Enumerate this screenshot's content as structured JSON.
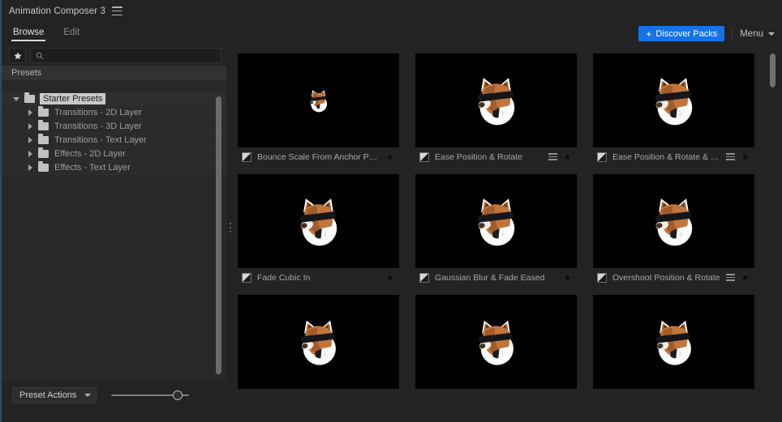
{
  "window": {
    "title": "Animation Composer 3",
    "menu_icon": "hamburger-icon"
  },
  "tabs": [
    {
      "label": "Browse",
      "active": true
    },
    {
      "label": "Edit",
      "active": false
    }
  ],
  "toolbar": {
    "discover_plus": "+",
    "discover_label": "Discover Packs",
    "menu_label": "Menu",
    "accent_color": "#1473e6"
  },
  "sidebar": {
    "favorites_icon": "star-icon",
    "search": {
      "icon": "search-icon",
      "value": "",
      "placeholder": ""
    },
    "tree_header": "Presets",
    "tree": [
      {
        "label": "Starter Presets",
        "level": 0,
        "expanded": true,
        "selected": true
      },
      {
        "label": "Transitions - 2D Layer",
        "level": 1,
        "expanded": false,
        "selected": false
      },
      {
        "label": "Transitions - 3D Layer",
        "level": 1,
        "expanded": false,
        "selected": false
      },
      {
        "label": "Transitions - Text Layer",
        "level": 1,
        "expanded": false,
        "selected": false
      },
      {
        "label": "Effects - 2D Layer",
        "level": 1,
        "expanded": false,
        "selected": false
      },
      {
        "label": "Effects - Text Layer",
        "level": 1,
        "expanded": false,
        "selected": false
      }
    ],
    "footer": {
      "actions_label": "Preset Actions",
      "slider_value": 80
    }
  },
  "grid": {
    "cards": [
      {
        "name": "Bounce Scale From Anchor Point",
        "has_lines": false,
        "has_star": true,
        "mascot_scale": 0.34
      },
      {
        "name": "Ease Position & Rotate",
        "has_lines": true,
        "has_star": true,
        "mascot_scale": 0.74
      },
      {
        "name": "Ease Position & Rotate & Scale",
        "has_lines": true,
        "has_star": true,
        "mascot_scale": 0.74
      },
      {
        "name": "Fade Cubic In",
        "has_lines": false,
        "has_star": true,
        "mascot_scale": 0.74
      },
      {
        "name": "Gaussian Blur & Fade Eased",
        "has_lines": false,
        "has_star": true,
        "mascot_scale": 0.74
      },
      {
        "name": "Overshoot Position & Rotate",
        "has_lines": true,
        "has_star": true,
        "mascot_scale": 0.74
      },
      {
        "name": "",
        "has_lines": false,
        "has_star": false,
        "mascot_scale": 0.7
      },
      {
        "name": "",
        "has_lines": false,
        "has_star": false,
        "mascot_scale": 0.7
      },
      {
        "name": "",
        "has_lines": false,
        "has_star": false,
        "mascot_scale": 0.7
      }
    ]
  }
}
